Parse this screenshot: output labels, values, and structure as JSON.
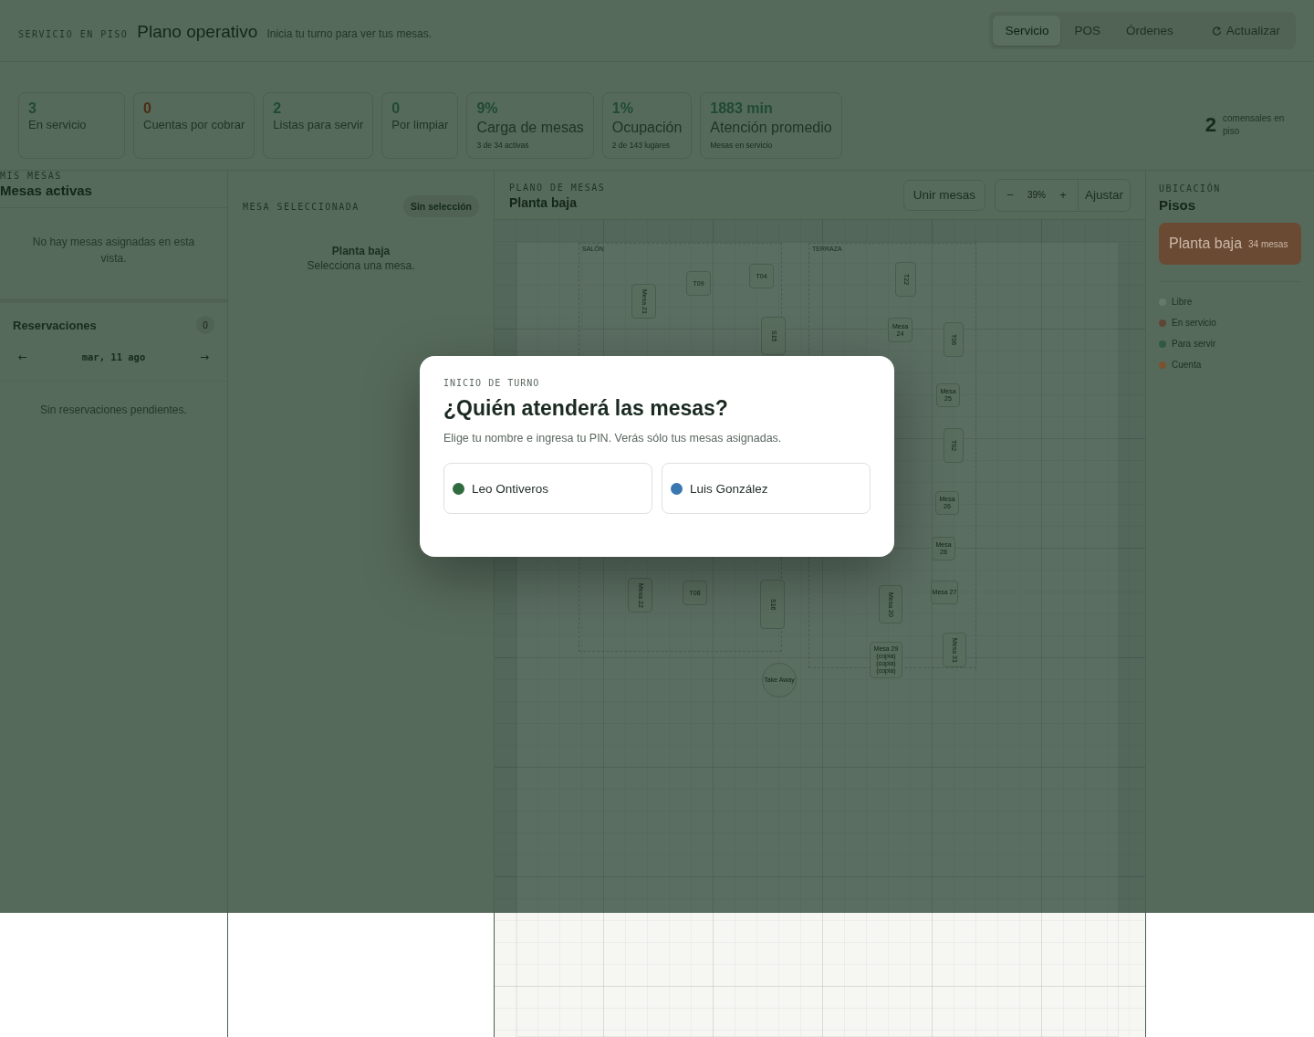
{
  "header": {
    "eyebrow": "SERVICIO EN PISO",
    "title": "Plano operativo",
    "subtitle": "Inicia tu turno para ver tus mesas.",
    "tabs": [
      {
        "label": "Servicio",
        "selected": true
      },
      {
        "label": "POS",
        "selected": false
      },
      {
        "label": "Órdenes",
        "selected": false
      }
    ],
    "refresh_button": "Actualizar"
  },
  "stats": [
    {
      "value": "3",
      "label": "En servicio",
      "color": "#1f4a33"
    },
    {
      "value": "0",
      "label": "Cuentas por cobrar",
      "color": "#4e2c12"
    },
    {
      "value": "2",
      "label": "Listas para servir",
      "color": "#1f4a33"
    },
    {
      "value": "0",
      "label": "Por limpiar",
      "color": "#1f4a33"
    },
    {
      "value": "9%",
      "label": "Carga de mesas",
      "note": "3 de 34 activas",
      "color": "#1f4a33"
    },
    {
      "value": "1%",
      "label": "Ocupación",
      "note": "2 de 143 lugares",
      "color": "#1f4a33"
    },
    {
      "value": "1883 min",
      "label": "Atención promedio",
      "note": "Mesas en servicio",
      "color": "#1f4a33"
    }
  ],
  "diners": {
    "value": "2",
    "label": "comensales en piso"
  },
  "my_tables": {
    "eyebrow": "MIS MESAS",
    "title": "Mesas activas",
    "empty": "No hay mesas asignadas en esta vista."
  },
  "reservations": {
    "title": "Reservaciones",
    "count": "0",
    "prev": "←",
    "date": "mar, 11 ago",
    "next": "→",
    "empty": "Sin reservaciones pendientes."
  },
  "selected_table": {
    "eyebrow": "MESA SELECCIONADA",
    "badge": "Sin selección",
    "floor": "Planta baja",
    "hint": "Selecciona una mesa."
  },
  "floor_plan": {
    "eyebrow": "PLANO DE MESAS",
    "title": "Planta baja",
    "merge_button": "Unir mesas",
    "zoom_out": "−",
    "zoom": "39%",
    "zoom_in": "+",
    "fit_button": "Ajustar",
    "zones": [
      "SALÓN",
      "TERRAZA"
    ],
    "tables": [
      {
        "name": "Mesa 21",
        "kind": "tall"
      },
      {
        "name": "T09",
        "kind": "square"
      },
      {
        "name": "T04",
        "kind": "square"
      },
      {
        "name": "T22",
        "kind": "tall"
      },
      {
        "name": "Mesa 24",
        "kind": "square"
      },
      {
        "name": "T06",
        "kind": "tall"
      },
      {
        "name": "S15",
        "kind": "tall"
      },
      {
        "name": "Mesa 25",
        "kind": "square"
      },
      {
        "name": "T02",
        "kind": "tall"
      },
      {
        "name": "Mesa 26",
        "kind": "square"
      },
      {
        "name": "Mesa 28",
        "kind": "square"
      },
      {
        "name": "Mesa 22",
        "kind": "tall"
      },
      {
        "name": "T08",
        "kind": "square"
      },
      {
        "name": "S16",
        "kind": "tall"
      },
      {
        "name": "Mesa 20",
        "kind": "tall"
      },
      {
        "name": "Mesa 27",
        "kind": "square"
      },
      {
        "name": "Mesa 29 (copia) (copia) (copia)",
        "kind": "square"
      },
      {
        "name": "Mesa 31",
        "kind": "tall"
      },
      {
        "name": "Take Away",
        "kind": "round"
      }
    ]
  },
  "location": {
    "eyebrow": "UBICACIÓN",
    "title": "Pisos",
    "floors": [
      {
        "name": "Planta baja",
        "count": "34 mesas",
        "selected": true
      }
    ],
    "legend": [
      {
        "label": "Libre",
        "color": "#67796b"
      },
      {
        "label": "En servicio",
        "color": "#5e4536"
      },
      {
        "label": "Para servir",
        "color": "#2f5a40"
      },
      {
        "label": "Cuenta",
        "color": "#7a5230"
      }
    ]
  },
  "modal": {
    "eyebrow": "INICIO DE TURNO",
    "title": "¿Quién atenderá las mesas?",
    "text": "Elige tu nombre e ingresa tu PIN. Verás sólo tus mesas asignadas.",
    "staff": [
      {
        "name": "Leo Ontiveros",
        "color": "#2f6b3f"
      },
      {
        "name": "Luis González",
        "color": "#3a76b0"
      }
    ]
  }
}
